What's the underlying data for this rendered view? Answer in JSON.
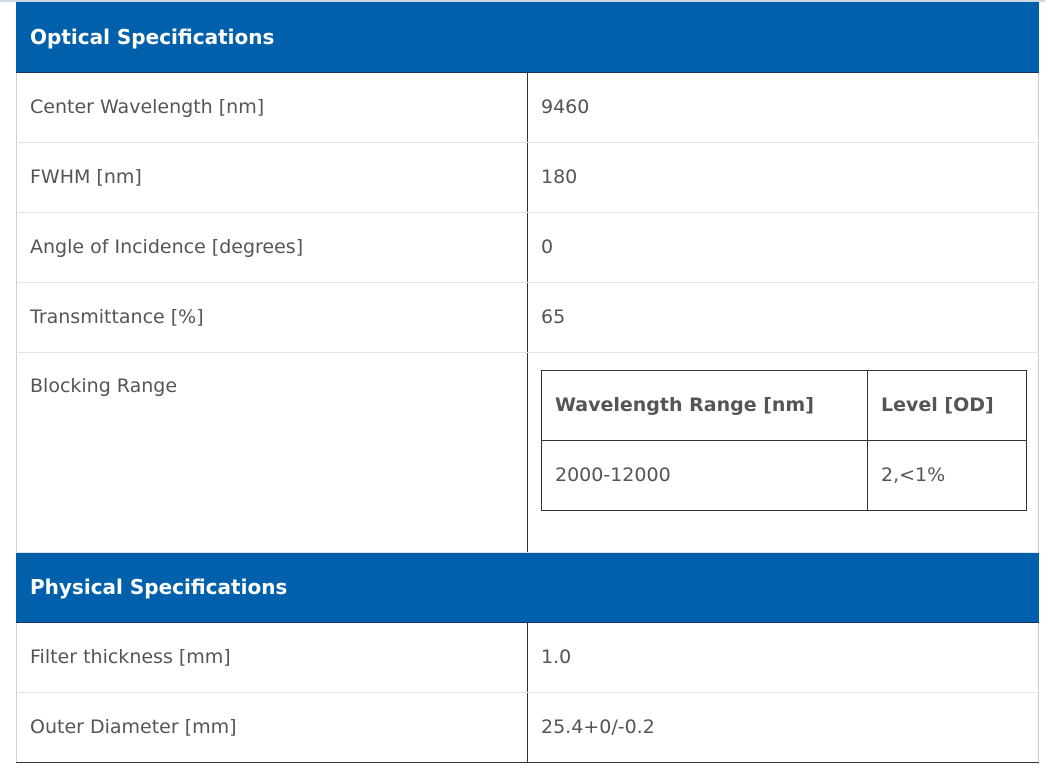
{
  "optical": {
    "title": "Optical Specifications",
    "rows": [
      {
        "label": "Center Wavelength [nm]",
        "value": "9460"
      },
      {
        "label": "FWHM [nm]",
        "value": "180"
      },
      {
        "label": "Angle of Incidence [degrees]",
        "value": "0"
      },
      {
        "label": "Transmittance [%]",
        "value": "65"
      }
    ],
    "blocking": {
      "label": "Blocking Range",
      "headers": [
        "Wavelength Range [nm]",
        "Level [OD]"
      ],
      "rows": [
        [
          "2000-12000",
          "2,<1%"
        ]
      ]
    }
  },
  "physical": {
    "title": "Physical Specifications",
    "rows": [
      {
        "label": "Filter thickness [mm]",
        "value": "1.0"
      },
      {
        "label": "Outer Diameter [mm]",
        "value": "25.4+0/-0.2"
      }
    ]
  },
  "colors": {
    "header_bg": "#0060ab",
    "header_text": "#ffffff",
    "body_text": "#555555"
  }
}
